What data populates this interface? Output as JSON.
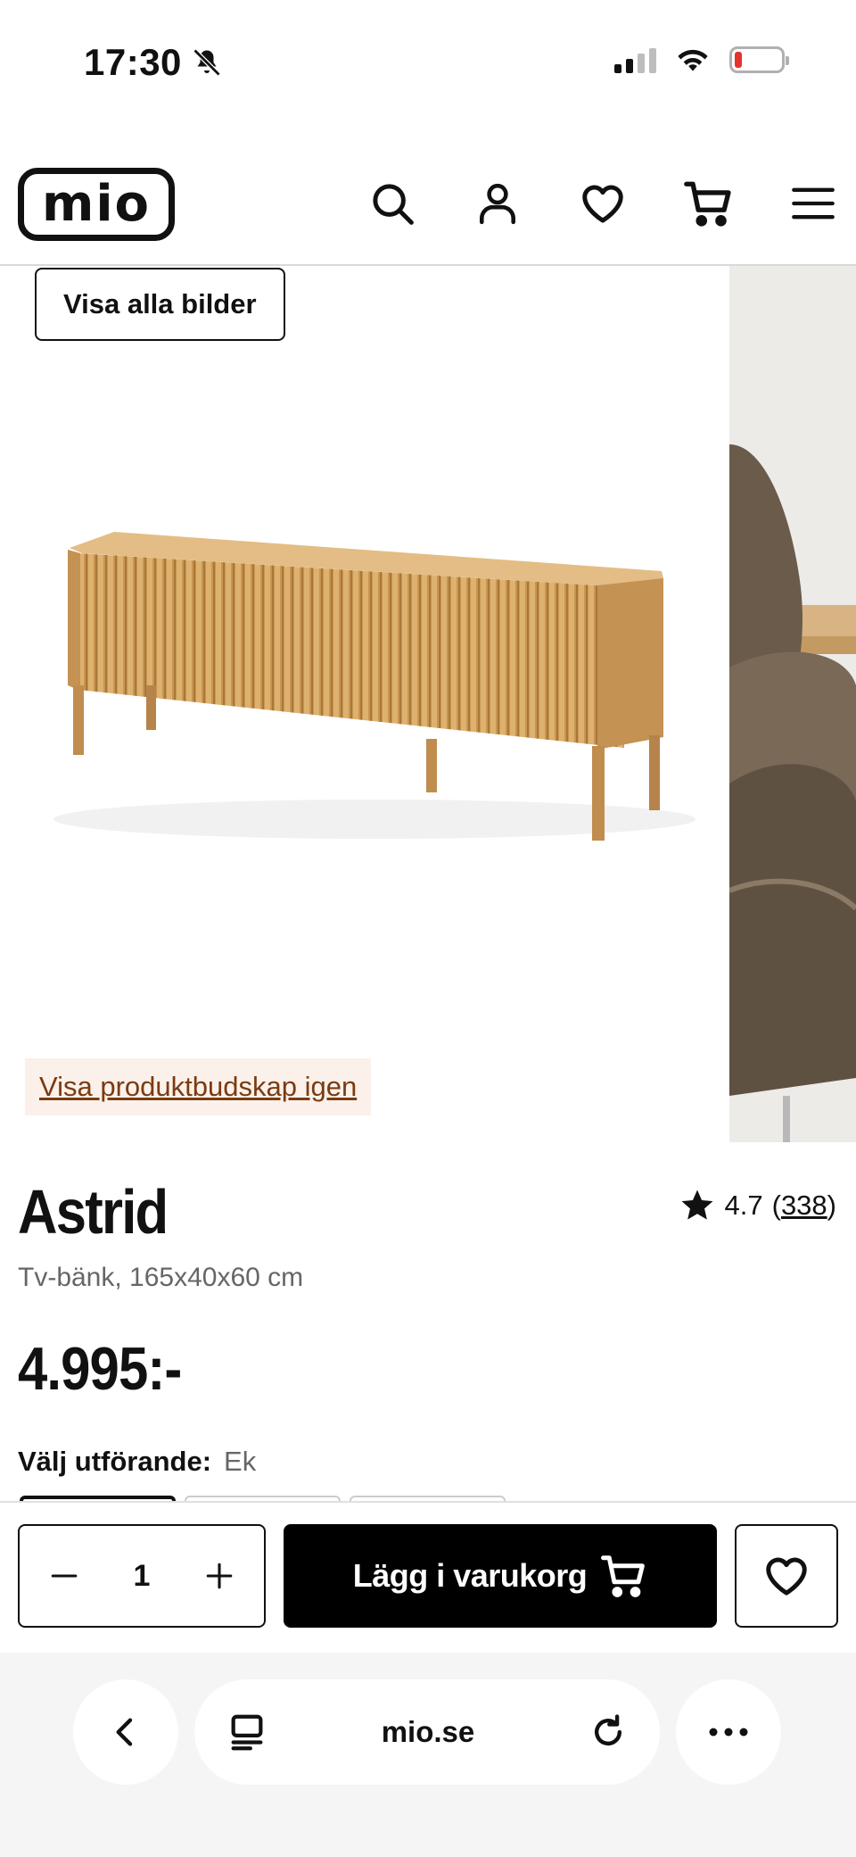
{
  "status_bar": {
    "time": "17:30"
  },
  "header": {
    "logo_text": "mio",
    "icons": [
      "search-icon",
      "account-icon",
      "heart-icon",
      "cart-icon",
      "menu-icon"
    ]
  },
  "gallery": {
    "show_all_label": "Visa alla bilder",
    "product_message_link": "Visa produktbudskap igen"
  },
  "product": {
    "name": "Astrid",
    "rating": "4.7",
    "review_count": "338",
    "rating_open": "(",
    "rating_close": ")",
    "subtitle": "Tv-bänk, 165x40x60 cm",
    "price": "4.995:-",
    "variant_label": "Välj utförande:",
    "variant_value": "Ek"
  },
  "buy_bar": {
    "quantity": "1",
    "add_to_cart_label": "Lägg i varukorg"
  },
  "browser": {
    "url": "mio.se"
  },
  "colors": {
    "accent": "#000000",
    "message_bg": "#fbf1ea",
    "message_text": "#7a3b12",
    "battery_low": "#e5322d"
  }
}
